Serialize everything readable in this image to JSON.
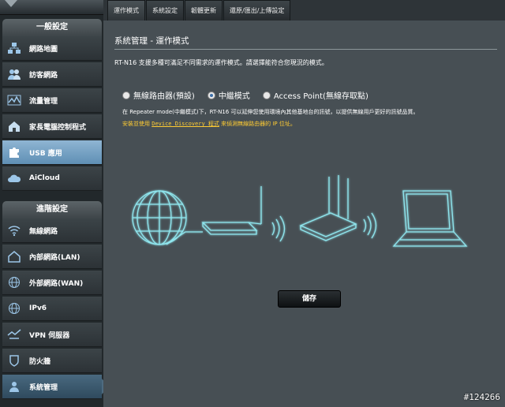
{
  "sidebar": {
    "section_general": "一般設定",
    "general_items": [
      {
        "label": "網路地圖",
        "icon": "network-map-icon"
      },
      {
        "label": "訪客網路",
        "icon": "guest-network-icon"
      },
      {
        "label": "流量管理",
        "icon": "traffic-manager-icon"
      },
      {
        "label": "家長電腦控制程式",
        "icon": "parental-control-icon"
      },
      {
        "label": "USB 應用",
        "icon": "usb-puzzle-icon"
      },
      {
        "label": "AiCloud",
        "icon": "aicloud-icon"
      }
    ],
    "section_advanced": "進階設定",
    "advanced_items": [
      {
        "label": "無線網路",
        "icon": "wireless-icon"
      },
      {
        "label": "內部網路(LAN)",
        "icon": "lan-home-icon"
      },
      {
        "label": "外部網路(WAN)",
        "icon": "wan-globe-icon"
      },
      {
        "label": "IPv6",
        "icon": "ipv6-globe-icon"
      },
      {
        "label": "VPN 伺服器",
        "icon": "vpn-icon"
      },
      {
        "label": "防火牆",
        "icon": "firewall-shield-icon"
      },
      {
        "label": "系統管理",
        "icon": "administration-icon"
      }
    ]
  },
  "tabs": [
    "運作模式",
    "系統設定",
    "韌體更新",
    "還原/匯出/上傳設定"
  ],
  "main": {
    "title": "系統管理 - 運作模式",
    "description": "RT-N16 支援多種可滿足不同需求的運作模式。請選擇能符合您現況的模式。",
    "options": [
      {
        "label": "無線路由器(預設)",
        "selected": false
      },
      {
        "label": "中繼模式",
        "selected": true
      },
      {
        "label": "Access Point(無線存取點)",
        "selected": false
      }
    ],
    "note": "在 Repeater mode(中繼模式)下，RT-N16 可以延伸您使用環境內其他基地台的訊號，以提供無線用戶更好的訊號品質。",
    "note2_prefix": "安裝並使用 ",
    "note2_link": "Device Discovery 程式",
    "note2_suffix": " 來偵測無線路由器的 IP 位址。",
    "save_label": "儲存"
  },
  "watermark": "#124266",
  "colors": {
    "accent": "#7fd6e0",
    "active_nav": "#7aa6c8",
    "warning_text": "#ffcc33"
  }
}
